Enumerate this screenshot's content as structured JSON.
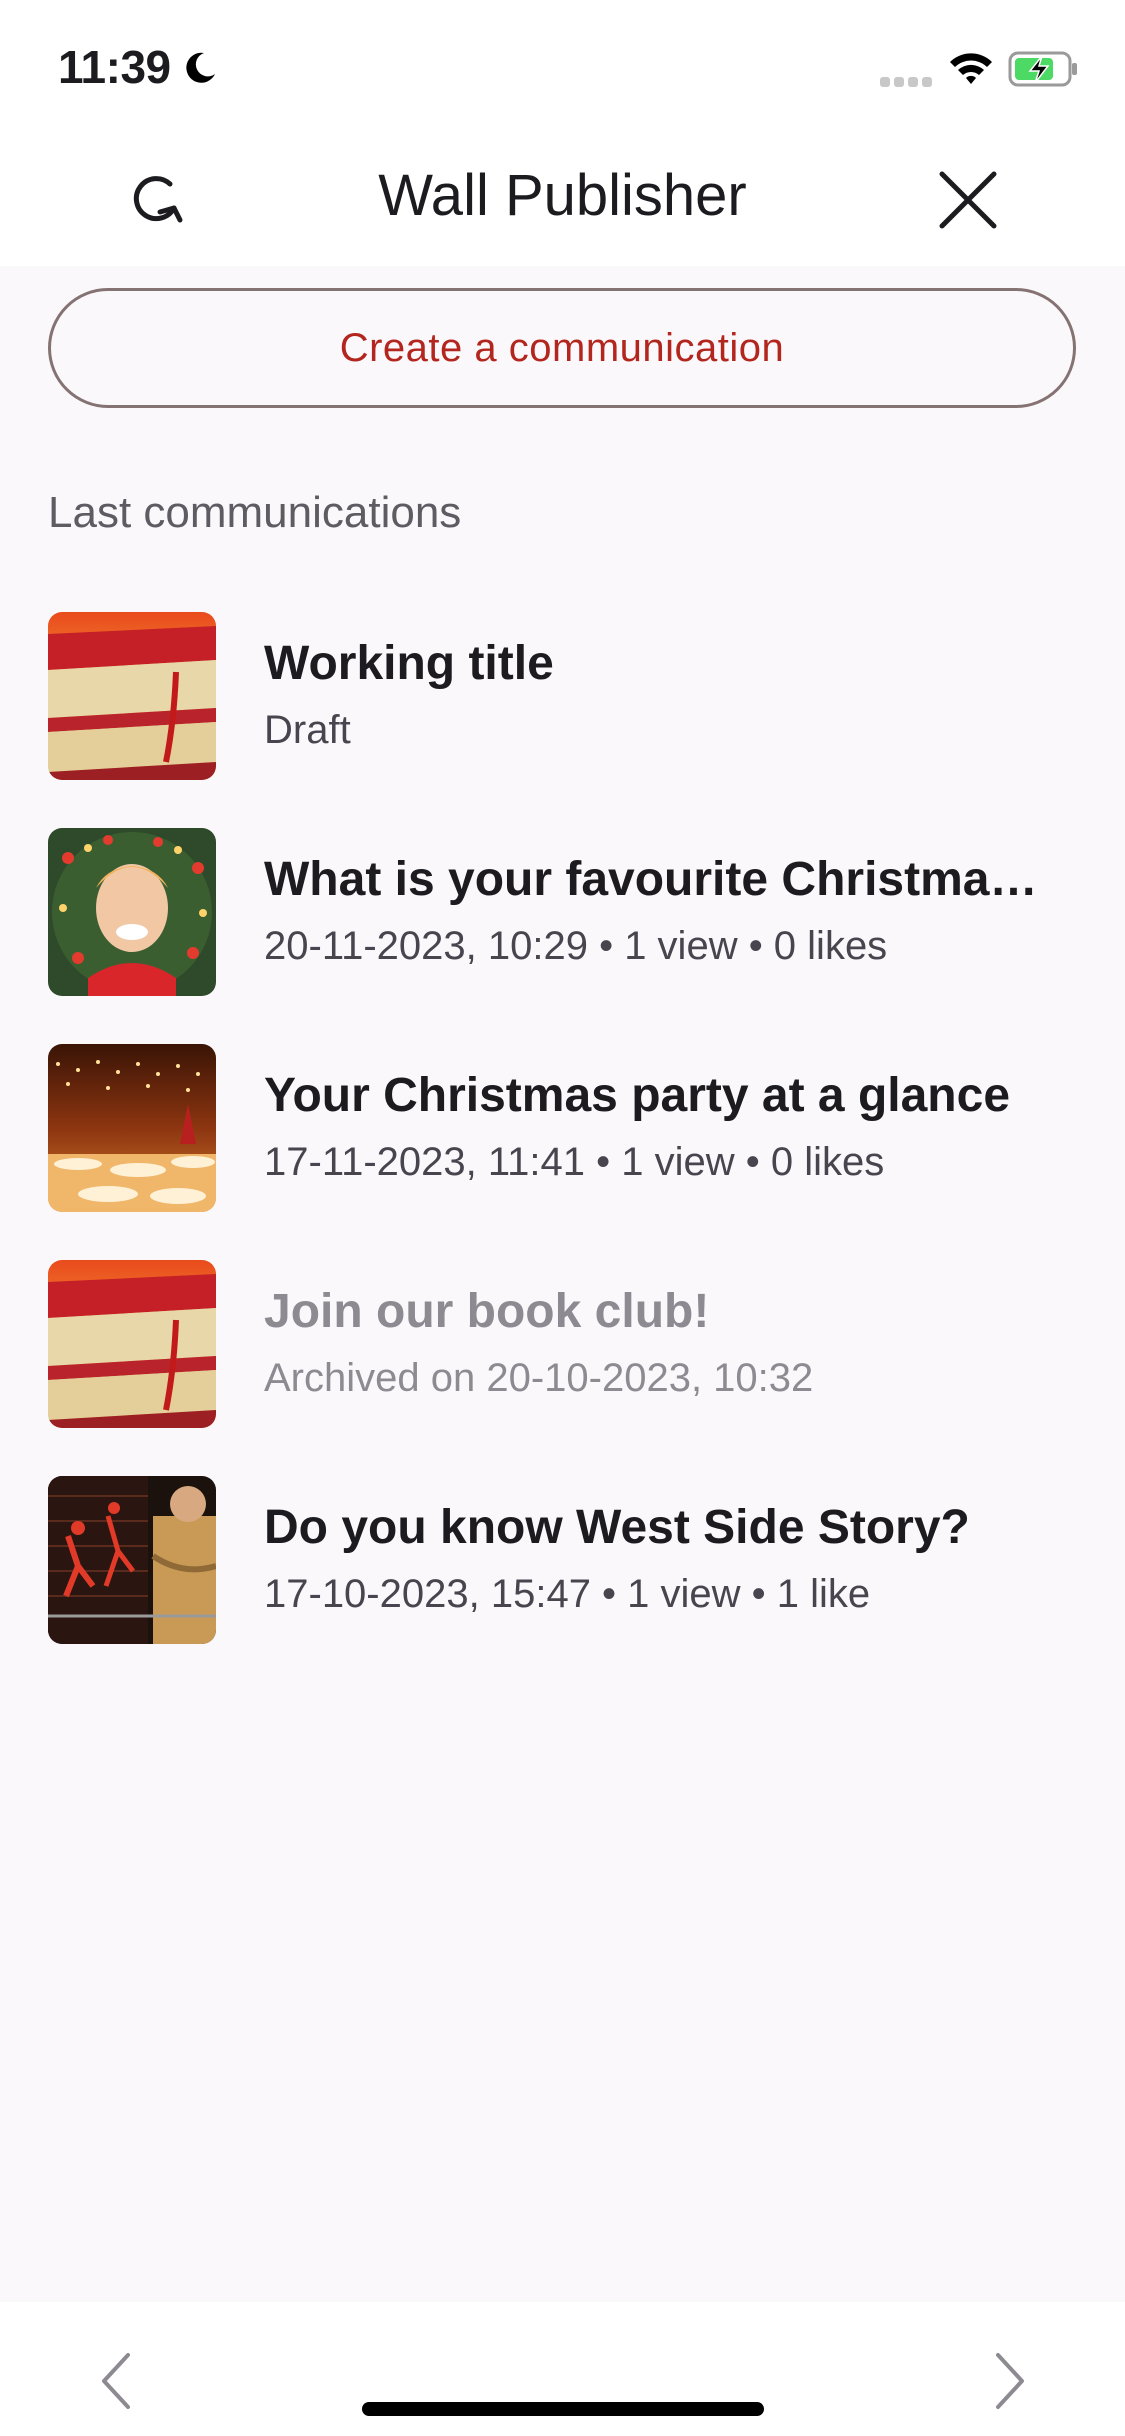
{
  "status_bar": {
    "time": "11:39",
    "icons": [
      "moon-icon",
      "cellular-signal-icon",
      "wifi-icon",
      "battery-charging-icon"
    ]
  },
  "app_bar": {
    "title": "Wall Publisher",
    "left_icon": "refresh-icon",
    "right_icon": "close-icon"
  },
  "create_button": {
    "label": "Create a communication"
  },
  "section": {
    "label": "Last communications"
  },
  "items": [
    {
      "title": "Working title",
      "subtitle": "Draft",
      "archived": false,
      "thumbnail": "books-image"
    },
    {
      "title": "What is your favourite Christmas …",
      "subtitle": "20-11-2023, 10:29 • 1 view • 0 likes",
      "archived": false,
      "thumbnail": "christmas-wreath-woman-image"
    },
    {
      "title": "Your Christmas party at a glance",
      "subtitle": "17-11-2023, 11:41 • 1 view • 0 likes",
      "archived": false,
      "thumbnail": "party-hall-image"
    },
    {
      "title": "Join our book club!",
      "subtitle": "Archived on 20-10-2023, 10:32",
      "archived": true,
      "thumbnail": "books-image"
    },
    {
      "title": "Do you know West Side Story?",
      "subtitle": "17-10-2023, 15:47 • 1 view • 1 like",
      "archived": false,
      "thumbnail": "west-side-story-image"
    }
  ],
  "bottom_bar": {
    "left_icon": "chevron-left-icon",
    "right_icon": "chevron-right-icon"
  },
  "colors": {
    "accent": "#b3261e",
    "outline": "#857373",
    "background": "#fbf8fc",
    "archived_text": "#8e8a91"
  }
}
